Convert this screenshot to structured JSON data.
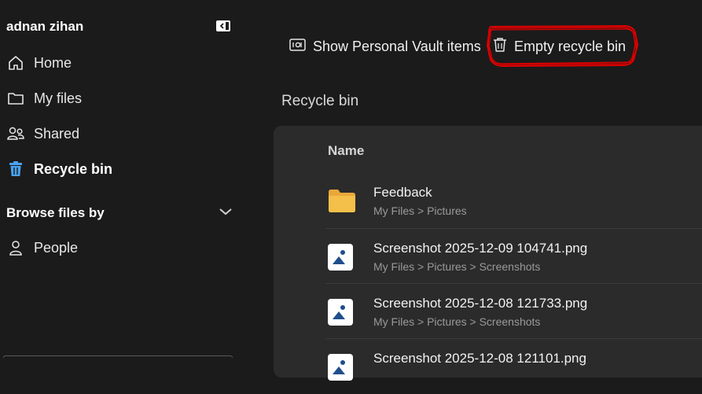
{
  "sidebar": {
    "user_name": "adnan zihan",
    "items": [
      {
        "label": "Home",
        "icon": "home-icon"
      },
      {
        "label": "My files",
        "icon": "folder-icon"
      },
      {
        "label": "Shared",
        "icon": "people-icon"
      },
      {
        "label": "Recycle bin",
        "icon": "trash-icon",
        "active": true
      }
    ],
    "browse_label": "Browse files by",
    "browse_items": [
      {
        "label": "People",
        "icon": "person-icon"
      }
    ]
  },
  "toolbar": {
    "vault_label": "Show Personal Vault items",
    "empty_label": "Empty recycle bin"
  },
  "main": {
    "title": "Recycle bin",
    "column_name": "Name",
    "rows": [
      {
        "name": "Feedback",
        "path": "My Files > Pictures",
        "type": "folder"
      },
      {
        "name": "Screenshot 2025-12-09 104741.png",
        "path": "My Files > Pictures > Screenshots",
        "type": "image"
      },
      {
        "name": "Screenshot 2025-12-08 121733.png",
        "path": "My Files > Pictures > Screenshots",
        "type": "image"
      },
      {
        "name": "Screenshot 2025-12-08 121101.png",
        "path": "",
        "type": "image"
      }
    ]
  },
  "colors": {
    "background": "#1b1b1b",
    "panel": "#2b2b2b",
    "accent_blue": "#4aa3f0",
    "highlight_red": "#e00000",
    "folder_yellow": "#f5c04a"
  }
}
